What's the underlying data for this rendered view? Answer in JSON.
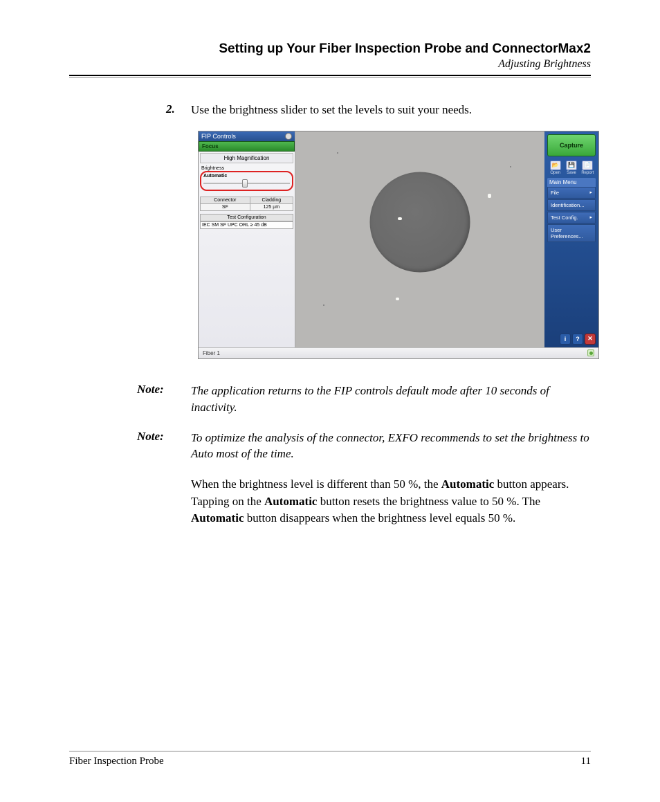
{
  "header": {
    "title": "Setting up Your Fiber Inspection Probe and ConnectorMax2",
    "subtitle": "Adjusting Brightness"
  },
  "step": {
    "number": "2.",
    "text": "Use the brightness slider to set the levels to suit your needs."
  },
  "screenshot": {
    "fip_title": "FIP Controls",
    "focus_label": "Focus",
    "magnification_btn": "High Magnification",
    "brightness_label": "Brightness",
    "automatic_label": "Automatic",
    "table": {
      "connector_h": "Connector",
      "cladding_h": "Cladding",
      "connector_v": "SF",
      "cladding_v": "125 µm"
    },
    "test_config_h": "Test Configuration",
    "test_config_v": "IEC SM SF UPC ORL ≥ 45 dB",
    "capture_btn": "Capture",
    "tool_icons": {
      "open": "Open",
      "save": "Save",
      "report": "Report"
    },
    "main_menu_label": "Main Menu",
    "menu": {
      "file": "File",
      "identification": "Identification...",
      "test_config": "Test Config.",
      "user_prefs": "User Preferences..."
    },
    "status_text": "Fiber 1"
  },
  "notes": {
    "label": "Note:",
    "note1": "The application returns to the FIP controls default mode after 10 seconds of inactivity.",
    "note2": "To optimize the analysis of the connector, EXFO recommends to set the brightness to Auto most of the time."
  },
  "paragraph": {
    "p1a": "When the brightness level is different than 50 %, the ",
    "auto": "Automatic",
    "p1b": " button appears. Tapping on the ",
    "p1c": " button resets the brightness value to 50 %. The ",
    "p1d": " button disappears when the brightness level equals 50 %."
  },
  "footer": {
    "left": "Fiber Inspection Probe",
    "right": "11"
  }
}
